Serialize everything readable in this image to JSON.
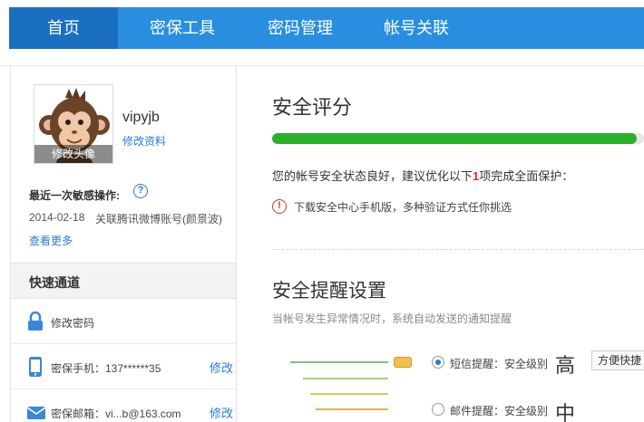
{
  "nav": {
    "items": [
      {
        "label": "首页",
        "active": true
      },
      {
        "label": "密保工具",
        "active": false
      },
      {
        "label": "密码管理",
        "active": false
      },
      {
        "label": "帐号关联",
        "active": false
      }
    ]
  },
  "sidebar": {
    "avatar_overlay": "修改头像",
    "username": "vipyjb",
    "edit_profile": "修改资料",
    "sensitive_title": "最近一次敏感操作:",
    "sensitive_date": "2014-02-18",
    "sensitive_desc": "关联腾讯微博账号(颜景波)",
    "see_more": "查看更多",
    "quick_title": "快速通道",
    "quick_items": [
      {
        "icon": "lock-icon",
        "label": "修改密码",
        "action": ""
      },
      {
        "icon": "phone-icon",
        "label": "密保手机：137******35",
        "action": "修改"
      },
      {
        "icon": "mail-icon",
        "label": "密保邮箱：vi...b@163.com",
        "action": "修改"
      }
    ]
  },
  "main": {
    "score_title": "安全评分",
    "progress": 0.98,
    "status_prefix": "您的帐号安全状态良好，建议优化以下",
    "status_count": "1",
    "status_suffix": "项完成全面保护：",
    "warn_text": "下载安全中心手机版，多种验证方式任你挑选",
    "remind_title": "安全提醒设置",
    "remind_sub": "当帐号发生异常情况时，系统自动发送的通知提醒",
    "options": [
      {
        "label": "短信提醒：安全级别",
        "level": "高",
        "checked": true
      },
      {
        "label": "邮件提醒：安全级别",
        "level": "中",
        "checked": false
      }
    ],
    "shortcut_label": "方便快捷"
  },
  "colors": {
    "nav_bg": "#2a8ee0",
    "nav_active": "#1a6fc0",
    "link": "#2a7ad5",
    "progress": "#2bb02b",
    "warn": "#e03030"
  }
}
